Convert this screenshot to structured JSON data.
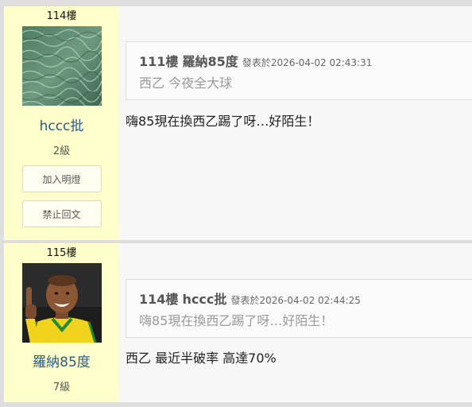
{
  "posts": [
    {
      "floor_label": "114樓",
      "username": "hccc批",
      "level": "2級",
      "buttons": {
        "follow": "加入明燈",
        "ban": "禁止回文"
      },
      "quote": {
        "floor": "111樓",
        "name": "羅納85度",
        "meta_prefix": "發表於",
        "timestamp": "2026-04-02 02:43:31",
        "text": "西乙 今夜全大球"
      },
      "text": "嗨85現在換西乙踢了呀…好陌生！"
    },
    {
      "floor_label": "115樓",
      "username": "羅納85度",
      "level": "7級",
      "quote": {
        "floor": "114樓",
        "name": "hccc批",
        "meta_prefix": "發表於",
        "timestamp": "2026-04-02 02:44:25",
        "text": "嗨85現在換西乙踢了呀…好陌生！"
      },
      "text": "西乙 最近半破率 高達70%"
    }
  ],
  "colors": {
    "sidebar_bg": "#ffffcc",
    "username": "#2a5a88",
    "page_bg": "#dedede",
    "post_bg": "#f7f7f7"
  },
  "icons": {
    "avatar_1": "water-texture-avatar",
    "avatar_2": "football-player-avatar"
  }
}
